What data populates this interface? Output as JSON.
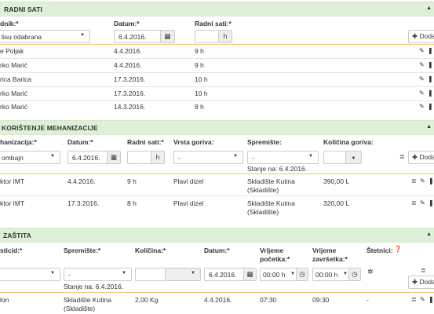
{
  "radni_sati": {
    "title": "RADNI SATI",
    "labels": {
      "radnik": "dnik:*",
      "datum": "Datum:*",
      "radni_sati": "Radni sati:*"
    },
    "form": {
      "radnik_value": "lisu odabrana",
      "datum_value": "6.4.2016.",
      "sati_unit": "h",
      "add_label": "Doda"
    },
    "rows": [
      {
        "name": "e Poljak",
        "date": "4.4.2016.",
        "hours": "9 h"
      },
      {
        "name": "rko Marić",
        "date": "4.4.2016.",
        "hours": "9 h"
      },
      {
        "name": "rica Barica",
        "date": "17.3.2016.",
        "hours": "10 h"
      },
      {
        "name": "rko Marić",
        "date": "17.3.2016.",
        "hours": "10 h"
      },
      {
        "name": "rko Marić",
        "date": "14.3.2016.",
        "hours": "8 h"
      }
    ]
  },
  "mehanizacija": {
    "title": "KORIŠTENJE MEHANIZACIJE",
    "labels": {
      "mehanizacija": "hanizacija:*",
      "datum": "Datum:*",
      "radni_sati": "Radni sati:*",
      "vrsta_goriva": "Vrsta goriva:",
      "spremiste": "Spremište:",
      "kolicina": "Količina goriva:"
    },
    "form": {
      "meh_value": "ombajn",
      "datum_value": "6.4.2016.",
      "sati_unit": "h",
      "gorivo_value": "-",
      "spremiste_value": "-",
      "stanje_text": "Stanje na: 6.4.2016.",
      "add_label": "Doda"
    },
    "rows": [
      {
        "name": "ktor IMT",
        "date": "4.4.2016.",
        "hours": "9 h",
        "fuel": "Plavi dizel",
        "store1": "Skladište Kutina",
        "store2": "(Skladište)",
        "amount": "390,00 L"
      },
      {
        "name": "ktor IMT",
        "date": "17.3.2016.",
        "hours": "8 h",
        "fuel": "Plavi dizel",
        "store1": "Skladište Kutina",
        "store2": "(Skladište)",
        "amount": "320,00 L"
      }
    ]
  },
  "zastita": {
    "title": "ZAŠTITA",
    "labels": {
      "pesticid": "sticid:*",
      "spremiste": "Spremište:*",
      "kolicina": "Količina:*",
      "datum": "Datum:*",
      "pocetak1": "Vrijeme",
      "pocetak2": "početka:*",
      "zavrsetak1": "Vrijeme",
      "zavrsetak2": "završetka:*",
      "stetnici": "Štetnici:"
    },
    "form": {
      "pesticid_value": "",
      "spremiste_value": "-",
      "datum_value": "6.4.2016.",
      "pocetak_value": "00:00 h",
      "zavrsetak_value": "00:00 h",
      "stanje_text": "Stanje na: 6.4.2016.",
      "add_label": "Doda"
    },
    "rows": [
      {
        "name": "lon",
        "store1": "Skladište Kutina",
        "store2": "(Skladište)",
        "amount": "2,00 Kg",
        "date": "4.4.2016.",
        "start": "07:30",
        "end": "09:30",
        "pests": "-"
      }
    ]
  }
}
